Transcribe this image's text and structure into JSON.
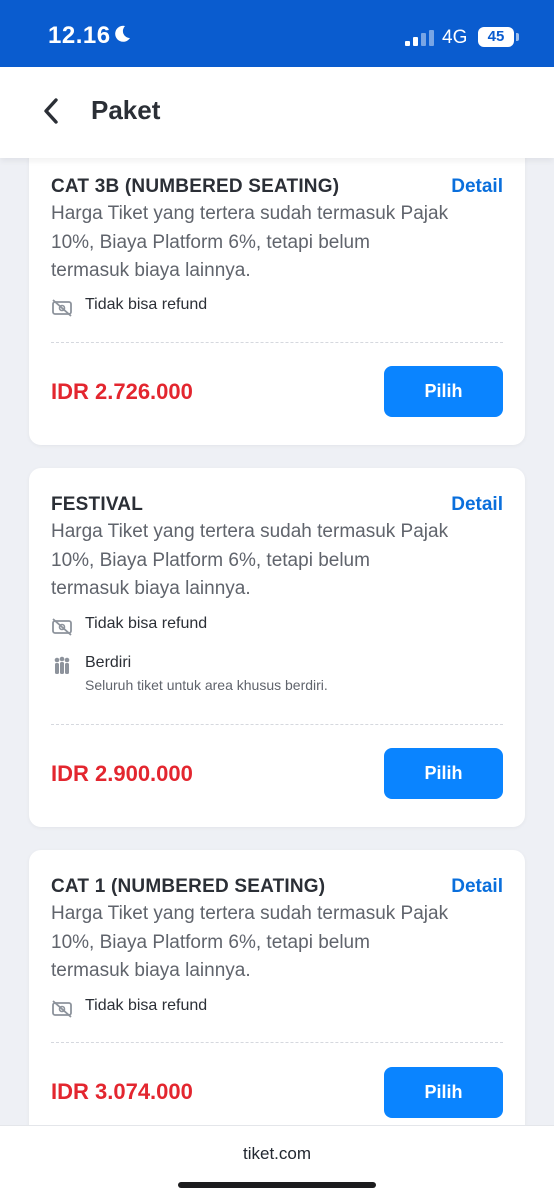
{
  "status_bar": {
    "time": "12.16",
    "network": "4G",
    "battery": "45"
  },
  "header": {
    "title": "Paket"
  },
  "packages": [
    {
      "name": "CAT 3B (NUMBERED SEATING)",
      "detail": "Detail",
      "description": "Harga Tiket yang tertera sudah termasuk Pajak 10%, Biaya Platform 6%, tetapi belum termasuk biaya lainnya.",
      "refund": "Tidak bisa refund",
      "price": "IDR 2.726.000",
      "button": "Pilih"
    },
    {
      "name": "FESTIVAL",
      "detail": "Detail",
      "description": "Harga Tiket yang tertera sudah termasuk Pajak 10%, Biaya Platform 6%, tetapi belum termasuk biaya lainnya.",
      "refund": "Tidak bisa refund",
      "standing": "Berdiri",
      "standing_note": "Seluruh tiket untuk area khusus berdiri.",
      "price": "IDR 2.900.000",
      "button": "Pilih"
    },
    {
      "name": "CAT 1 (NUMBERED SEATING)",
      "detail": "Detail",
      "description": "Harga Tiket yang tertera sudah termasuk Pajak 10%, Biaya Platform 6%, tetapi belum termasuk biaya lainnya.",
      "refund": "Tidak bisa refund",
      "price": "IDR 3.074.000",
      "button": "Pilih"
    }
  ],
  "footer": {
    "domain": "tiket.com"
  },
  "colors": {
    "brand": "#0a5ccf",
    "button": "#0a84ff",
    "price": "#e3262f",
    "link": "#0a6fdc"
  },
  "icons": {
    "back": "chevron-left-icon",
    "refund": "no-refund-icon",
    "standing": "standing-people-icon",
    "moon": "moon-icon"
  }
}
